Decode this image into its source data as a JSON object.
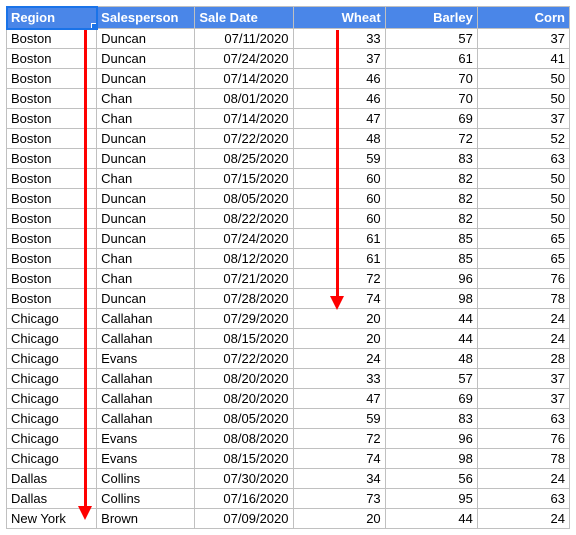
{
  "table": {
    "headers": {
      "region": "Region",
      "salesperson": "Salesperson",
      "sale_date": "Sale Date",
      "wheat": "Wheat",
      "barley": "Barley",
      "corn": "Corn"
    },
    "rows": [
      {
        "region": "Boston",
        "salesperson": "Duncan",
        "date": "07/11/2020",
        "wheat": "33",
        "barley": "57",
        "corn": "37"
      },
      {
        "region": "Boston",
        "salesperson": "Duncan",
        "date": "07/24/2020",
        "wheat": "37",
        "barley": "61",
        "corn": "41"
      },
      {
        "region": "Boston",
        "salesperson": "Duncan",
        "date": "07/14/2020",
        "wheat": "46",
        "barley": "70",
        "corn": "50"
      },
      {
        "region": "Boston",
        "salesperson": "Chan",
        "date": "08/01/2020",
        "wheat": "46",
        "barley": "70",
        "corn": "50"
      },
      {
        "region": "Boston",
        "salesperson": "Chan",
        "date": "07/14/2020",
        "wheat": "47",
        "barley": "69",
        "corn": "37"
      },
      {
        "region": "Boston",
        "salesperson": "Duncan",
        "date": "07/22/2020",
        "wheat": "48",
        "barley": "72",
        "corn": "52"
      },
      {
        "region": "Boston",
        "salesperson": "Duncan",
        "date": "08/25/2020",
        "wheat": "59",
        "barley": "83",
        "corn": "63"
      },
      {
        "region": "Boston",
        "salesperson": "Chan",
        "date": "07/15/2020",
        "wheat": "60",
        "barley": "82",
        "corn": "50"
      },
      {
        "region": "Boston",
        "salesperson": "Duncan",
        "date": "08/05/2020",
        "wheat": "60",
        "barley": "82",
        "corn": "50"
      },
      {
        "region": "Boston",
        "salesperson": "Duncan",
        "date": "08/22/2020",
        "wheat": "60",
        "barley": "82",
        "corn": "50"
      },
      {
        "region": "Boston",
        "salesperson": "Duncan",
        "date": "07/24/2020",
        "wheat": "61",
        "barley": "85",
        "corn": "65"
      },
      {
        "region": "Boston",
        "salesperson": "Chan",
        "date": "08/12/2020",
        "wheat": "61",
        "barley": "85",
        "corn": "65"
      },
      {
        "region": "Boston",
        "salesperson": "Chan",
        "date": "07/21/2020",
        "wheat": "72",
        "barley": "96",
        "corn": "76"
      },
      {
        "region": "Boston",
        "salesperson": "Duncan",
        "date": "07/28/2020",
        "wheat": "74",
        "barley": "98",
        "corn": "78"
      },
      {
        "region": "Chicago",
        "salesperson": "Callahan",
        "date": "07/29/2020",
        "wheat": "20",
        "barley": "44",
        "corn": "24"
      },
      {
        "region": "Chicago",
        "salesperson": "Callahan",
        "date": "08/15/2020",
        "wheat": "20",
        "barley": "44",
        "corn": "24"
      },
      {
        "region": "Chicago",
        "salesperson": "Evans",
        "date": "07/22/2020",
        "wheat": "24",
        "barley": "48",
        "corn": "28"
      },
      {
        "region": "Chicago",
        "salesperson": "Callahan",
        "date": "08/20/2020",
        "wheat": "33",
        "barley": "57",
        "corn": "37"
      },
      {
        "region": "Chicago",
        "salesperson": "Callahan",
        "date": "08/20/2020",
        "wheat": "47",
        "barley": "69",
        "corn": "37"
      },
      {
        "region": "Chicago",
        "salesperson": "Callahan",
        "date": "08/05/2020",
        "wheat": "59",
        "barley": "83",
        "corn": "63"
      },
      {
        "region": "Chicago",
        "salesperson": "Evans",
        "date": "08/08/2020",
        "wheat": "72",
        "barley": "96",
        "corn": "76"
      },
      {
        "region": "Chicago",
        "salesperson": "Evans",
        "date": "08/15/2020",
        "wheat": "74",
        "barley": "98",
        "corn": "78"
      },
      {
        "region": "Dallas",
        "salesperson": "Collins",
        "date": "07/30/2020",
        "wheat": "34",
        "barley": "56",
        "corn": "24"
      },
      {
        "region": "Dallas",
        "salesperson": "Collins",
        "date": "07/16/2020",
        "wheat": "73",
        "barley": "95",
        "corn": "63"
      },
      {
        "region": "New York",
        "salesperson": "Brown",
        "date": "07/09/2020",
        "wheat": "20",
        "barley": "44",
        "corn": "24"
      }
    ]
  }
}
